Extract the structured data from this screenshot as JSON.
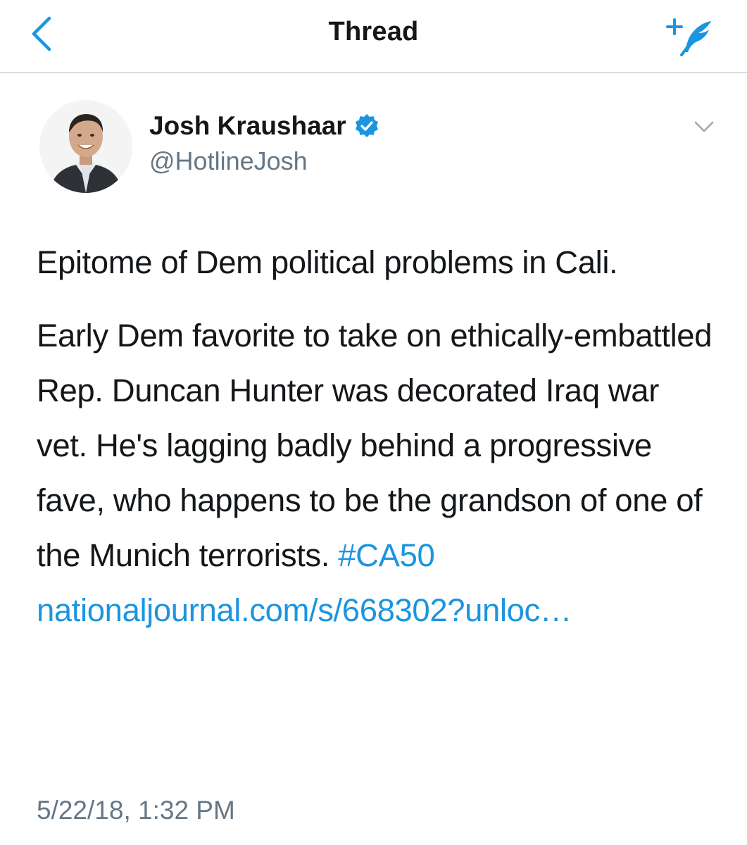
{
  "header": {
    "title": "Thread",
    "back_icon": "chevron-left-icon",
    "compose_icon": "compose-tweet-icon"
  },
  "tweet": {
    "author": {
      "name": "Josh Kraushaar",
      "handle": "@HotlineJosh",
      "verified_icon": "verified-badge-icon"
    },
    "menu_icon": "chevron-down-icon",
    "text_para1": "Epitome of Dem political problems in Cali.",
    "text_para2": "Early Dem favorite to take on ethically-embattled Rep. Duncan Hunter was decorated Iraq war vet. He's lagging badly behind a progressive fave, who happens to be the grandson of one of the Munich terrorists.",
    "hashtag": "#CA50",
    "link": "nationaljournal.com/s/668302?unloc…",
    "timestamp": "5/22/18, 1:32 PM"
  },
  "colors": {
    "accent": "#1b95e0",
    "text": "#14171a",
    "secondary": "#657786",
    "divider": "#d9dde1"
  }
}
